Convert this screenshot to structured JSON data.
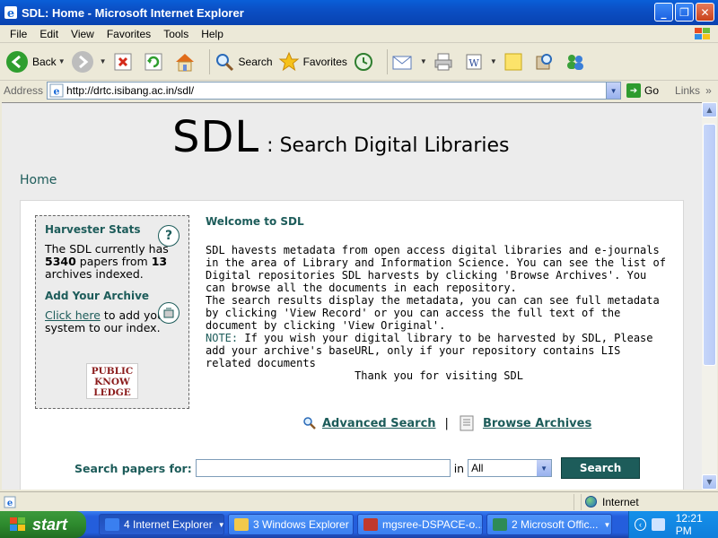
{
  "window": {
    "title": "SDL: Home - Microsoft Internet Explorer",
    "minimize": "_",
    "maximize": "❐",
    "close": "✕"
  },
  "menu": [
    "File",
    "Edit",
    "View",
    "Favorites",
    "Tools",
    "Help"
  ],
  "toolbar": {
    "back_label": "Back",
    "search_label": "Search",
    "favorites_label": "Favorites"
  },
  "address": {
    "label": "Address",
    "url": "http://drtc.isibang.ac.in/sdl/",
    "go_label": "Go",
    "links_label": "Links"
  },
  "page": {
    "title_big": "SDL",
    "title_sub": ": Search Digital Libraries",
    "home_link": "Home",
    "harvester": {
      "heading": "Harvester Stats",
      "text_prefix": "The SDL currently has",
      "papers_count": "5340",
      "text_mid": "papers from",
      "archives_count": "13",
      "text_suffix": "archives indexed."
    },
    "add_archive": {
      "heading": "Add Your Archive",
      "link": "Click here",
      "text": "to add your system to our index."
    },
    "pkp_logo": [
      "PUBLIC",
      "KNOW",
      "LEDGE"
    ],
    "welcome": {
      "heading": "Welcome to SDL",
      "para1": "SDL havests metadata from open access digital libraries and e-journals in the area of Library and Information Science. You can see the list of Digital repositories SDL harvests by clicking 'Browse Archives'. You can browse all the documents in each repository.",
      "para2": "The search results display the metadata, you can can see full metadata by clicking 'View Record' or you can access the full text of the document by clicking 'View Original'.",
      "note_label": "NOTE:",
      "note": " If you wish your digital library to be harvested by SDL, Please add your archive's baseURL, only if your repository contains LIS related documents",
      "thanks": "Thank you for visiting SDL"
    },
    "actions": {
      "advanced_search": "Advanced Search",
      "separator": "|",
      "browse_archives": "Browse Archives"
    },
    "search": {
      "label": "Search papers for:",
      "value": "",
      "in_label": "in",
      "scope_selected": "All",
      "button": "Search"
    }
  },
  "status": {
    "main": "",
    "zone": "Internet"
  },
  "taskbar": {
    "start": "start",
    "tasks": [
      {
        "label": "4 Internet Explorer",
        "icon_color": "#3a7ff0"
      },
      {
        "label": "3 Windows Explorer",
        "icon_color": "#f2c94c"
      },
      {
        "label": "mgsree-DSPACE-o...",
        "icon_color": "#c0392b"
      },
      {
        "label": "2 Microsoft Offic...",
        "icon_color": "#2e8b57"
      }
    ],
    "clock": "12:21 PM"
  }
}
